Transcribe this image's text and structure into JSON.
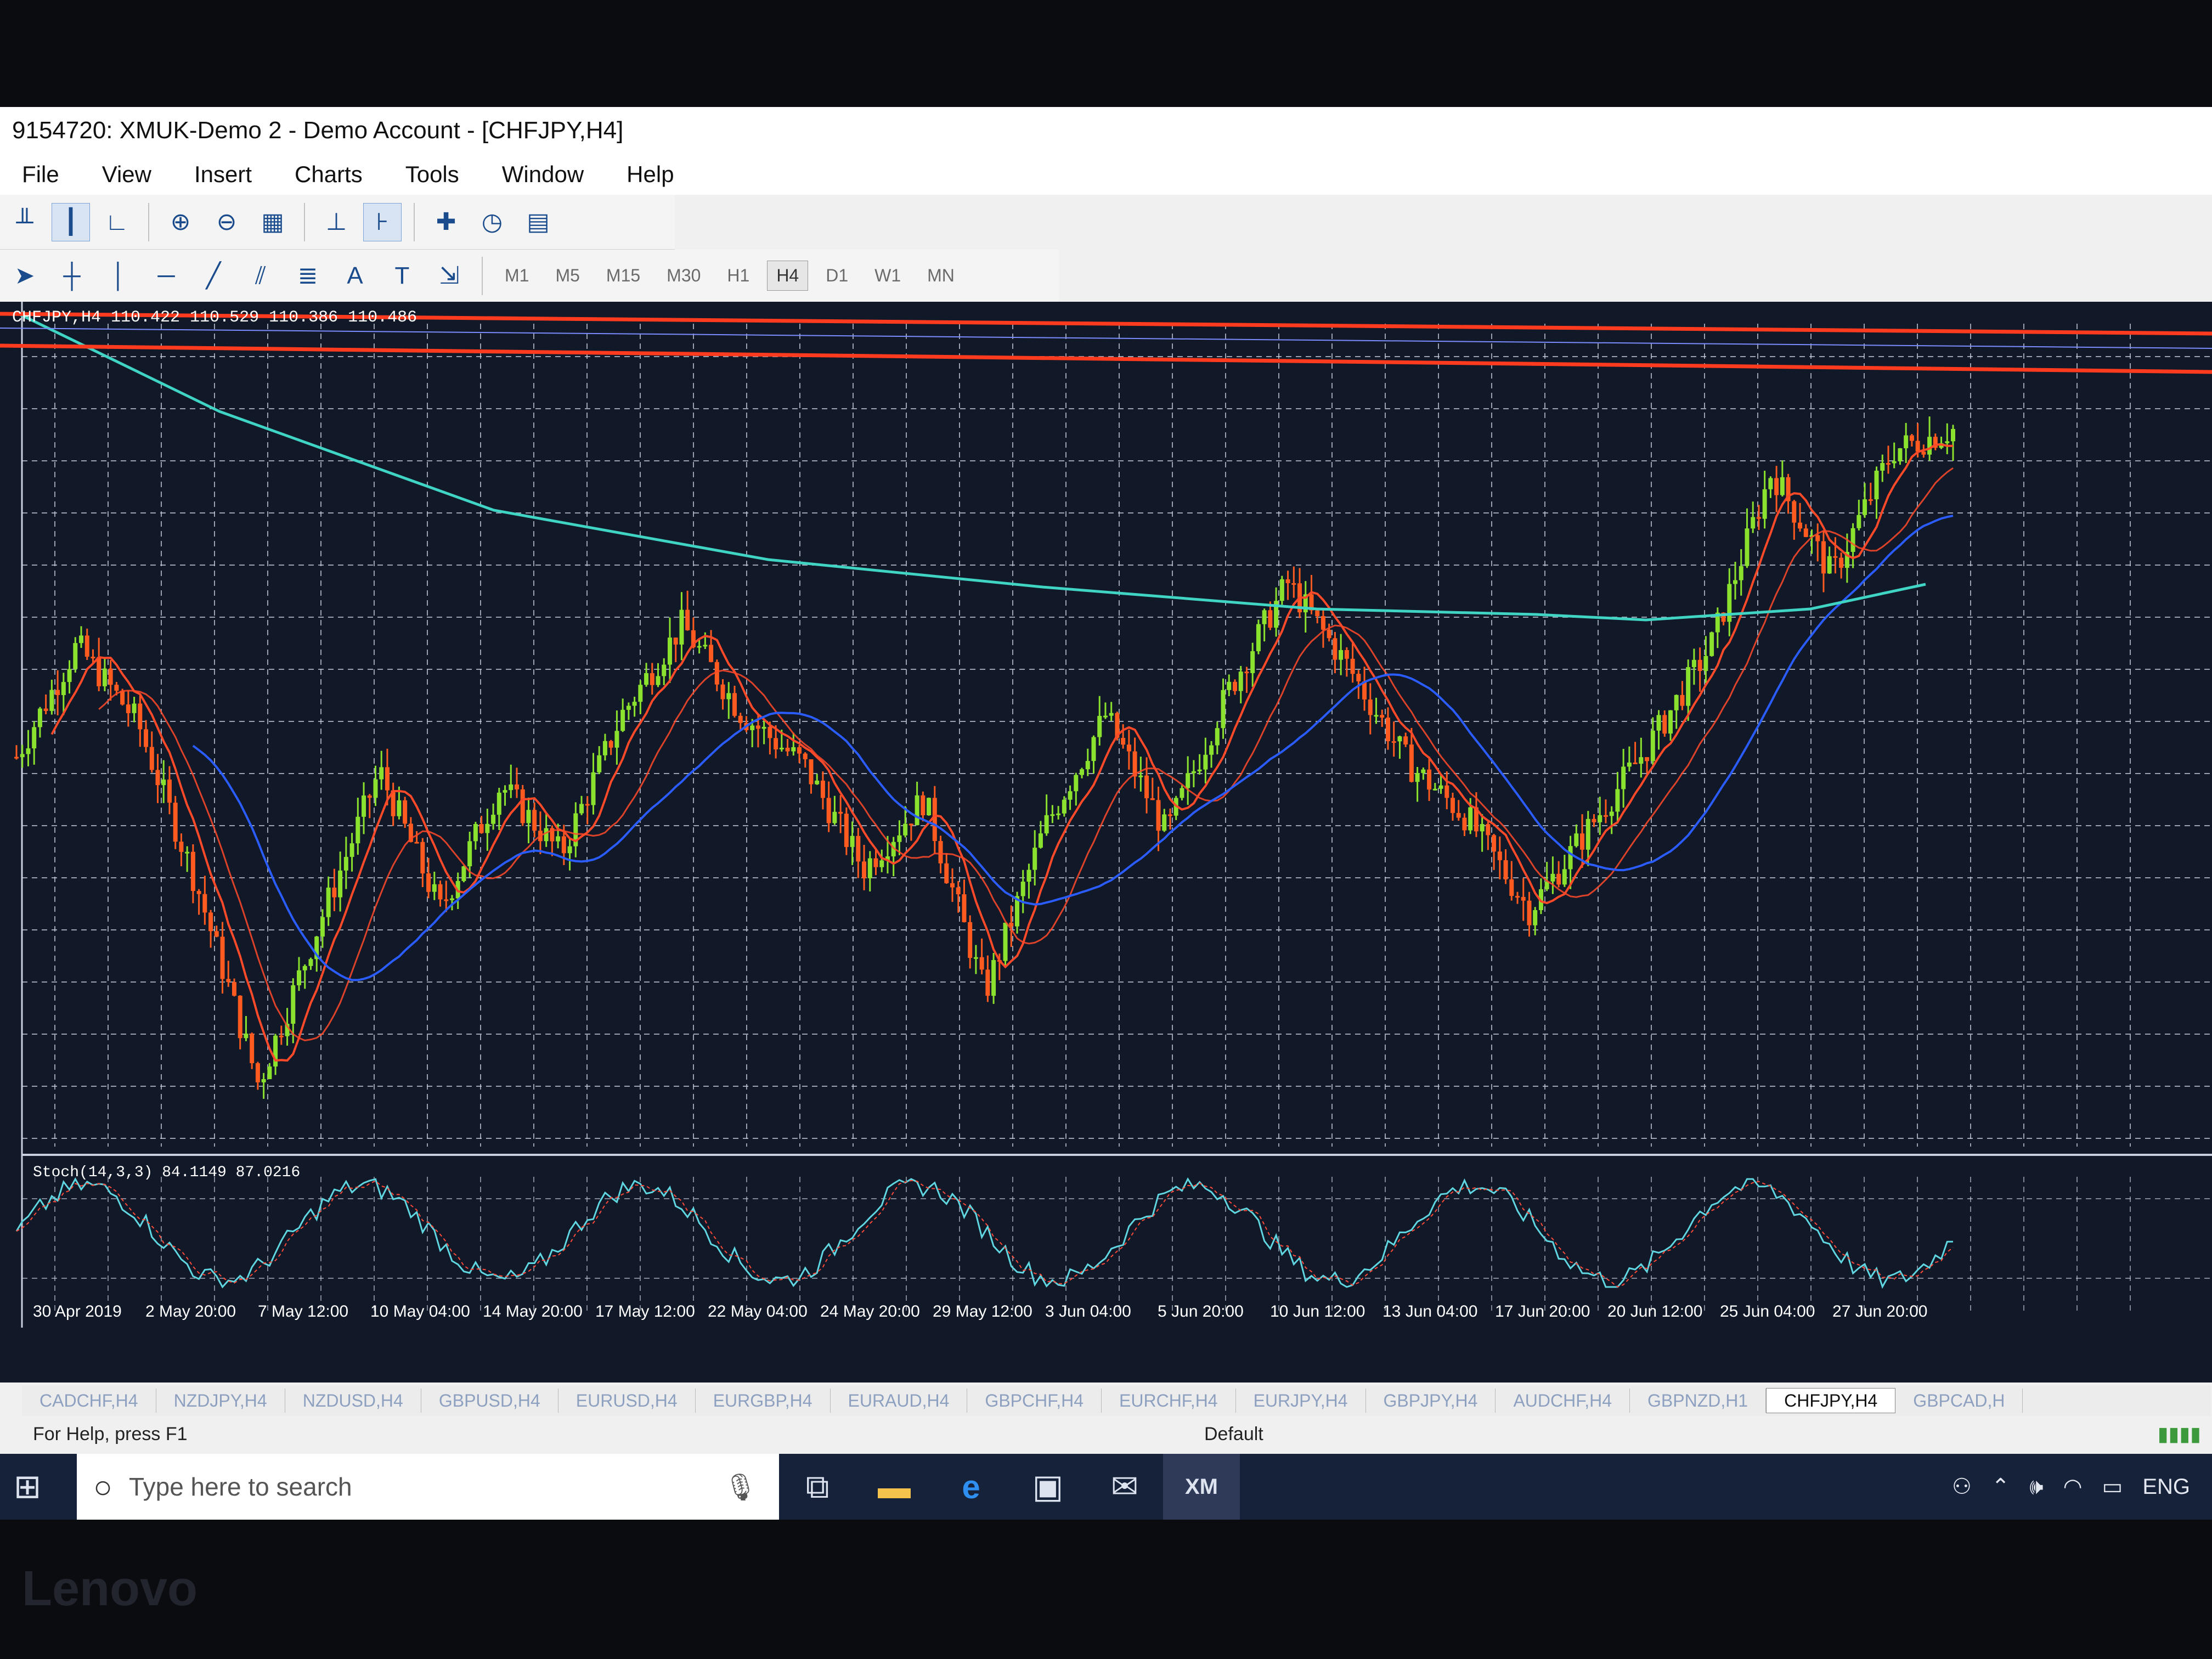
{
  "window": {
    "title": "9154720: XMUK-Demo 2 - Demo Account - [CHFJPY,H4]"
  },
  "menu": [
    "File",
    "View",
    "Insert",
    "Charts",
    "Tools",
    "Window",
    "Help"
  ],
  "timeframes": [
    "M1",
    "M5",
    "M15",
    "M30",
    "H1",
    "H4",
    "D1",
    "W1",
    "MN"
  ],
  "active_timeframe": "H4",
  "chart": {
    "header": "CHFJPY,H4  110.422 110.529 110.386 110.486",
    "indicator_label": "Stoch(14,3,3) 84.1149 87.0216"
  },
  "chart_data": {
    "type": "candlestick",
    "symbol": "CHFJPY",
    "timeframe": "H4",
    "ohlc": {
      "open": 110.422,
      "high": 110.529,
      "low": 110.386,
      "close": 110.486
    },
    "x_tick_labels": [
      "30 Apr 2019",
      "2 May 20:00",
      "7 May 12:00",
      "10 May 04:00",
      "14 May 20:00",
      "17 May 12:00",
      "22 May 04:00",
      "24 May 20:00",
      "29 May 12:00",
      "3 Jun 04:00",
      "5 Jun 20:00",
      "10 Jun 12:00",
      "13 Jun 04:00",
      "17 Jun 20:00",
      "20 Jun 12:00",
      "25 Jun 04:00",
      "27 Jun 20:00"
    ],
    "price_path_relative": [
      0.52,
      0.68,
      0.57,
      0.33,
      0.05,
      0.28,
      0.5,
      0.3,
      0.48,
      0.38,
      0.58,
      0.71,
      0.58,
      0.51,
      0.36,
      0.46,
      0.18,
      0.42,
      0.58,
      0.41,
      0.61,
      0.77,
      0.65,
      0.51,
      0.43,
      0.3,
      0.42,
      0.54,
      0.68,
      0.93,
      0.78,
      0.96,
      0.99
    ],
    "stochastic": {
      "k": 84.1149,
      "d": 87.0216
    },
    "colors": {
      "bull": "#8be22e",
      "bear": "#ff5a1f",
      "ma_fast": "#ff4a2a",
      "ma_mid": "#2a5cff",
      "ma_slow": "#3fd4c4",
      "hline": "#ff3b1f",
      "grid": "#c8d0e0"
    },
    "grid": true
  },
  "symbol_tabs": [
    "CADCHF,H4",
    "NZDJPY,H4",
    "NZDUSD,H4",
    "GBPUSD,H4",
    "EURUSD,H4",
    "EURGBP,H4",
    "EURAUD,H4",
    "GBPCHF,H4",
    "EURCHF,H4",
    "EURJPY,H4",
    "GBPJPY,H4",
    "AUDCHF,H4",
    "GBPNZD,H1",
    "CHFJPY,H4",
    "GBPCAD,H"
  ],
  "active_symbol_tab": "CHFJPY,H4",
  "status": {
    "help": "For Help, press F1",
    "profile": "Default"
  },
  "taskbar": {
    "search_placeholder": "Type here to search",
    "language": "ENG",
    "app_label": "XM"
  },
  "bezel": {
    "brand": "Lenovo"
  }
}
